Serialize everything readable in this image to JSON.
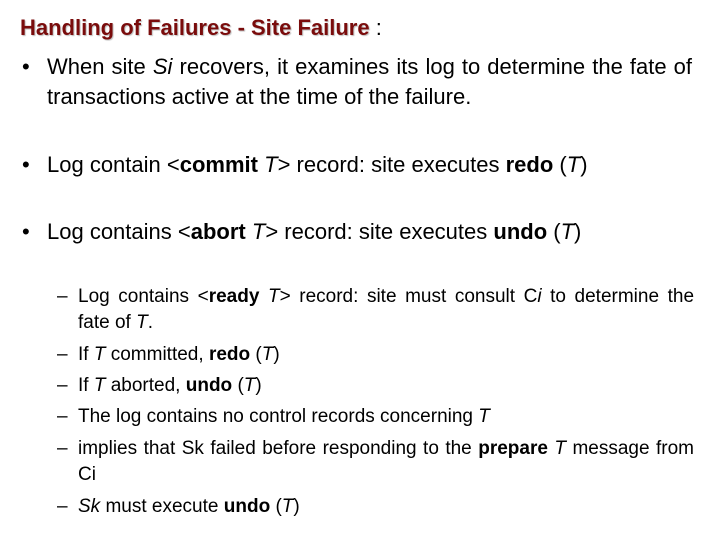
{
  "title": {
    "text": "Handling of Failures - Site Failure",
    "suffix": " :",
    "color": "#7a0c0c"
  },
  "bullets": [
    {
      "marker": "•",
      "parts": [
        {
          "t": "When site "
        },
        {
          "t": "Si",
          "s": "i"
        },
        {
          "t": " recovers, it examines its log to determine the fate of transactions active at the time of the failure."
        }
      ]
    },
    {
      "marker": "•",
      "parts": [
        {
          "t": "Log contain <"
        },
        {
          "t": "commit",
          "s": "b"
        },
        {
          "t": " "
        },
        {
          "t": "T",
          "s": "i"
        },
        {
          "t": "> record: site executes "
        },
        {
          "t": "redo",
          "s": "b"
        },
        {
          "t": " ("
        },
        {
          "t": "T",
          "s": "i"
        },
        {
          "t": ")"
        }
      ]
    },
    {
      "marker": "•",
      "parts": [
        {
          "t": "Log contains <"
        },
        {
          "t": "abort",
          "s": "b"
        },
        {
          "t": " "
        },
        {
          "t": "T",
          "s": "i"
        },
        {
          "t": "> record: site executes "
        },
        {
          "t": "undo",
          "s": "b"
        },
        {
          "t": " ("
        },
        {
          "t": "T",
          "s": "i"
        },
        {
          "t": ")"
        }
      ]
    }
  ],
  "subbullets": [
    {
      "marker": "–",
      "parts": [
        {
          "t": "Log contains <"
        },
        {
          "t": "ready",
          "s": "b"
        },
        {
          "t": " "
        },
        {
          "t": "T",
          "s": "i"
        },
        {
          "t": "> record: site must consult C"
        },
        {
          "t": "i",
          "s": "i"
        },
        {
          "t": " to determine the fate of "
        },
        {
          "t": "T",
          "s": "i"
        },
        {
          "t": "."
        }
      ]
    },
    {
      "marker": "–",
      "parts": [
        {
          "t": "If "
        },
        {
          "t": "T",
          "s": "i"
        },
        {
          "t": " committed, "
        },
        {
          "t": "redo",
          "s": "b"
        },
        {
          "t": " ("
        },
        {
          "t": "T",
          "s": "i"
        },
        {
          "t": ")"
        }
      ]
    },
    {
      "marker": "–",
      "parts": [
        {
          "t": "If "
        },
        {
          "t": "T",
          "s": "i"
        },
        {
          "t": " aborted, "
        },
        {
          "t": "undo",
          "s": "b"
        },
        {
          "t": " ("
        },
        {
          "t": "T",
          "s": "i"
        },
        {
          "t": ")"
        }
      ]
    },
    {
      "marker": "–",
      "parts": [
        {
          "t": "The log contains no control records concerning "
        },
        {
          "t": "T",
          "s": "i"
        }
      ]
    },
    {
      "marker": "–",
      "parts": [
        {
          "t": "implies that Sk failed before responding to the  "
        },
        {
          "t": "prepare",
          "s": "b"
        },
        {
          "t": " "
        },
        {
          "t": "T",
          "s": "i"
        },
        {
          "t": " message from Ci"
        }
      ]
    },
    {
      "marker": "–",
      "parts": [
        {
          "t": "Sk",
          "s": "i"
        },
        {
          "t": " must execute "
        },
        {
          "t": "undo",
          "s": "b"
        },
        {
          "t": " ("
        },
        {
          "t": "T",
          "s": "i"
        },
        {
          "t": ")"
        }
      ]
    }
  ]
}
